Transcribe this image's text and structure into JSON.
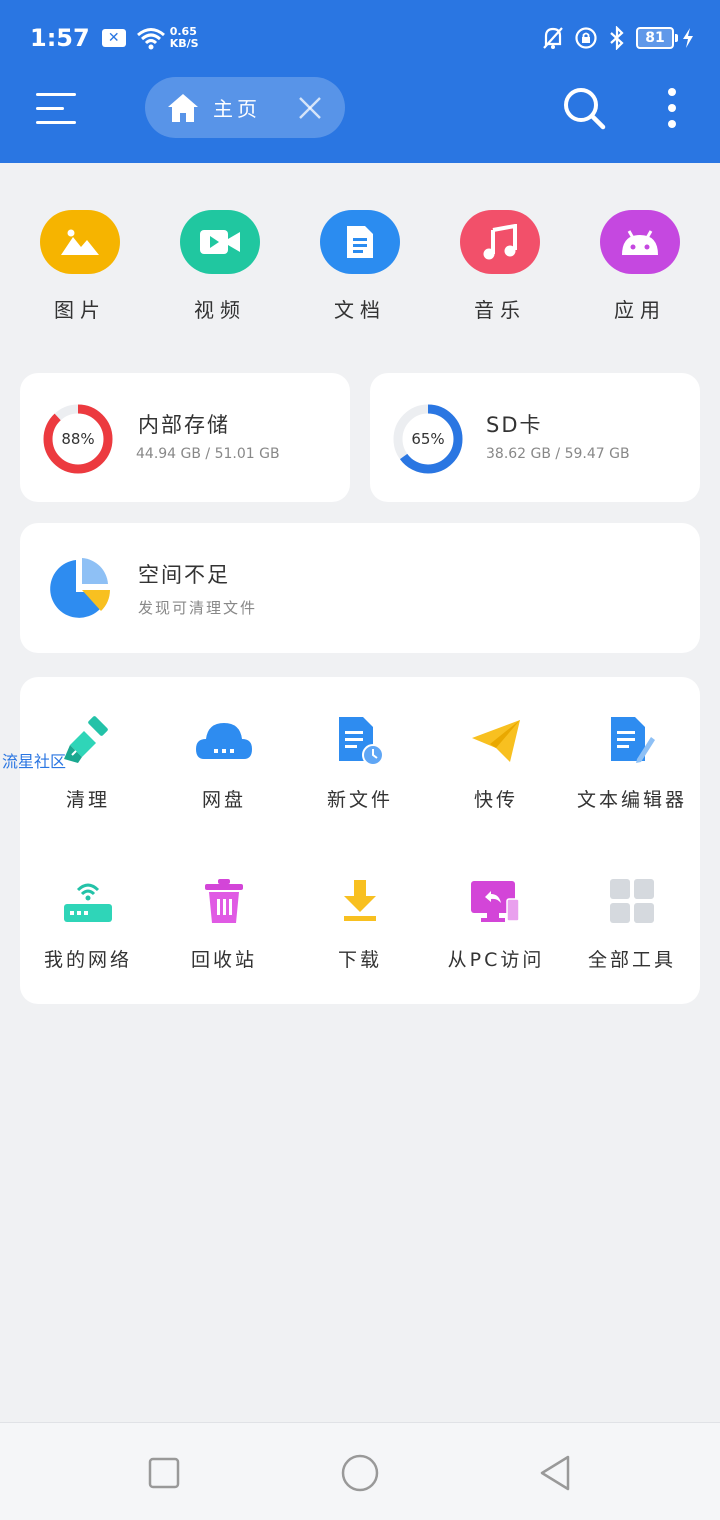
{
  "status_bar": {
    "time": "1:57",
    "net_speed_value": "0.65",
    "net_speed_unit": "KB/S",
    "battery": "81"
  },
  "header": {
    "tab_label": "主页",
    "icons": [
      "menu-icon",
      "home-icon",
      "close-icon",
      "search-icon",
      "more-vertical-icon"
    ],
    "bg_color": "#2a76e2"
  },
  "categories": [
    {
      "label": "图片",
      "icon": "image-icon",
      "color": "#f6b400"
    },
    {
      "label": "视频",
      "icon": "video-icon",
      "color": "#20c7a0"
    },
    {
      "label": "文档",
      "icon": "document-icon",
      "color": "#2b8cf0"
    },
    {
      "label": "音乐",
      "icon": "music-icon",
      "color": "#f2506a"
    },
    {
      "label": "应用",
      "icon": "android-icon",
      "color": "#c548e0"
    }
  ],
  "storage": {
    "internal": {
      "title": "内部存储",
      "percent_label": "88%",
      "percent": 88,
      "used_total": "44.94 GB / 51.01 GB",
      "color": "#ec3a3f"
    },
    "sd": {
      "title": "SD卡",
      "percent_label": "65%",
      "percent": 65,
      "used_total": "38.62 GB / 59.47 GB",
      "color": "#2a76e2"
    }
  },
  "space_warning": {
    "title": "空间不足",
    "subtitle": "发现可清理文件"
  },
  "tools": [
    {
      "label": "清理",
      "icon": "broom-icon"
    },
    {
      "label": "网盘",
      "icon": "cloud-drive-icon"
    },
    {
      "label": "新文件",
      "icon": "new-file-icon"
    },
    {
      "label": "快传",
      "icon": "paper-plane-icon"
    },
    {
      "label": "文本编辑器",
      "icon": "text-editor-icon"
    },
    {
      "label": "我的网络",
      "icon": "router-icon"
    },
    {
      "label": "回收站",
      "icon": "trash-icon"
    },
    {
      "label": "下载",
      "icon": "download-icon"
    },
    {
      "label": "从PC访问",
      "icon": "pc-access-icon"
    },
    {
      "label": "全部工具",
      "icon": "all-tools-icon"
    }
  ],
  "watermark": "流星社区",
  "navbar": {
    "icons": [
      "recent-apps-icon",
      "home-circle-icon",
      "back-icon"
    ]
  }
}
